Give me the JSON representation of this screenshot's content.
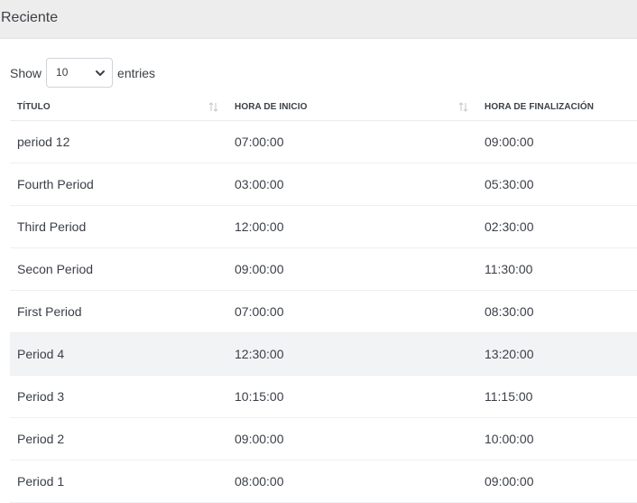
{
  "header": {
    "title": "Reciente"
  },
  "length_control": {
    "prefix": "Show",
    "selected": "10",
    "suffix": "entries"
  },
  "table": {
    "columns": [
      {
        "label": "TÍTULO"
      },
      {
        "label": "HORA DE INICIO"
      },
      {
        "label": "HORA DE FINALIZACIÓN"
      }
    ],
    "rows": [
      {
        "title": "period 12",
        "start": "07:00:00",
        "end": "09:00:00"
      },
      {
        "title": "Fourth Period",
        "start": "03:00:00",
        "end": "05:30:00"
      },
      {
        "title": "Third Period",
        "start": "12:00:00",
        "end": "02:30:00"
      },
      {
        "title": "Secon Period",
        "start": "09:00:00",
        "end": "11:30:00"
      },
      {
        "title": "First Period",
        "start": "07:00:00",
        "end": "08:30:00"
      },
      {
        "title": "Period 4",
        "start": "12:30:00",
        "end": "13:20:00"
      },
      {
        "title": "Period 3",
        "start": "10:15:00",
        "end": "11:15:00"
      },
      {
        "title": "Period 2",
        "start": "09:00:00",
        "end": "10:00:00"
      },
      {
        "title": "Period 1",
        "start": "08:00:00",
        "end": "09:00:00"
      }
    ]
  },
  "icons": {
    "select": "chevron-down-icon",
    "sort": "sort-arrows-icon"
  },
  "colors": {
    "header_bg": "#ededed",
    "hover_row": "#f2f3f5",
    "text": "#3a3f47",
    "sort_icon": "#c2c6cc"
  }
}
